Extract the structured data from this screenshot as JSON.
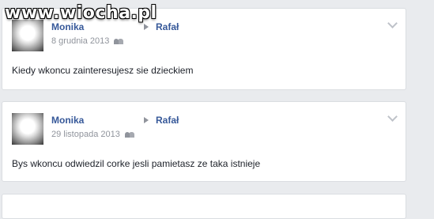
{
  "watermark": "www.wiocha.pl",
  "posts": [
    {
      "author": "Monika",
      "target": "Rafał",
      "date": "8 grudnia 2013",
      "audience_icon": "friends-icon",
      "text": "Kiedy wkoncu zainteresujesz sie dzieckiem"
    },
    {
      "author": "Monika",
      "target": "Rafał",
      "date": "29 listopada 2013",
      "audience_icon": "friends-icon",
      "text": "Bys wkoncu odwiedzil corke jesli pamietasz ze taka istnieje"
    }
  ],
  "colors": {
    "link": "#365899",
    "meta": "#90949c",
    "background": "#e9ebee"
  }
}
